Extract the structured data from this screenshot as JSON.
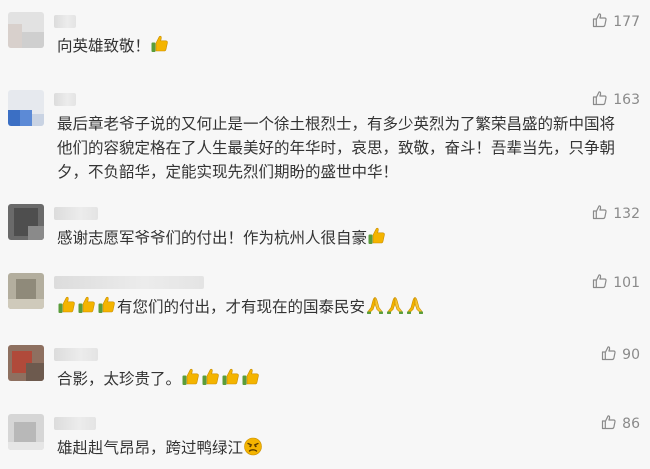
{
  "icons": {
    "like": "thumbs-up-outline-icon",
    "thumbs": "thumbs-up-emoji",
    "pray": "folded-hands-emoji",
    "angry": "angry-face-emoji"
  },
  "colors": {
    "background": "#f7f7f7",
    "text": "#333333",
    "muted": "#8a8a8a",
    "emoji_yellow": "#f4b400",
    "emoji_green": "#5a9d3a"
  },
  "comments": [
    {
      "segments": [
        {
          "t": "向英雄致敬！"
        },
        {
          "e": "thumbs"
        }
      ],
      "likes": "177"
    },
    {
      "segments": [
        {
          "t": "最后章老爷子说的又何止是一个徐土根烈士，有多少英烈为了繁荣昌盛的新中国将\n他们的容貌定格在了人生最美好的年华时，哀思，致敬，奋斗！吾辈当先，只争朝\n夕，不负韶华，定能实现先烈们期盼的盛世中华！"
        }
      ],
      "likes": "163"
    },
    {
      "segments": [
        {
          "t": "感谢志愿军爷爷们的付出！作为杭州人很自豪"
        },
        {
          "e": "thumbs"
        }
      ],
      "likes": "132"
    },
    {
      "segments": [
        {
          "e": "thumbs"
        },
        {
          "e": "thumbs"
        },
        {
          "e": "thumbs"
        },
        {
          "t": "有您们的付出，才有现在的国泰民安"
        },
        {
          "e": "pray"
        },
        {
          "e": "pray"
        },
        {
          "e": "pray"
        }
      ],
      "likes": "101"
    },
    {
      "segments": [
        {
          "t": "合影，太珍贵了。"
        },
        {
          "e": "thumbs"
        },
        {
          "e": "thumbs"
        },
        {
          "e": "thumbs"
        },
        {
          "e": "thumbs"
        }
      ],
      "likes": "90"
    },
    {
      "segments": [
        {
          "t": "雄赳赳气昂昂，跨过鸭绿江"
        },
        {
          "e": "angry"
        }
      ],
      "likes": "86"
    }
  ]
}
